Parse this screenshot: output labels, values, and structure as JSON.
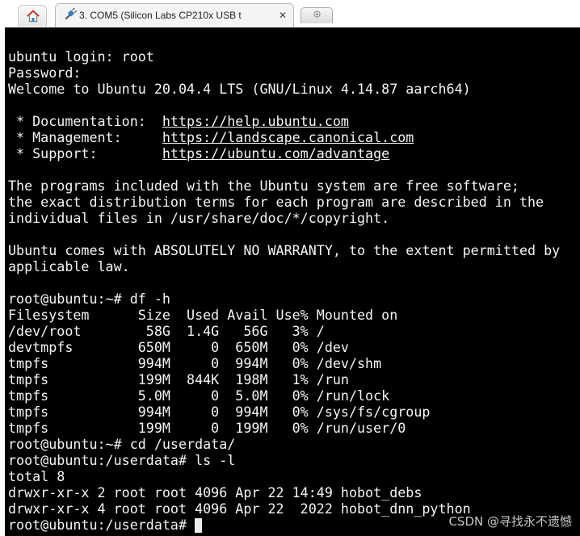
{
  "tabs": {
    "home_icon": "home-icon",
    "session_icon": "serial-plug-icon",
    "session_title": "3. COM5  (Silicon Labs CP210x USB t",
    "close_glyph": "✕",
    "new_tab_icon": "add-tab-icon"
  },
  "terminal": {
    "lines": [
      "ubuntu login: root",
      "Password:",
      "Welcome to Ubuntu 20.04.4 LTS (GNU/Linux 4.14.87 aarch64)",
      "",
      " * Documentation:  ",
      " * Management:     ",
      " * Support:        ",
      "",
      "The programs included with the Ubuntu system are free software;",
      "the exact distribution terms for each program are described in the",
      "individual files in /usr/share/doc/*/copyright.",
      "",
      "Ubuntu comes with ABSOLUTELY NO WARRANTY, to the extent permitted by",
      "applicable law.",
      "",
      "root@ubuntu:~# df -h",
      "Filesystem      Size  Used Avail Use% Mounted on",
      "/dev/root        58G  1.4G   56G   3% /",
      "devtmpfs        650M     0  650M   0% /dev",
      "tmpfs           994M     0  994M   0% /dev/shm",
      "tmpfs           199M  844K  198M   1% /run",
      "tmpfs           5.0M     0  5.0M   0% /run/lock",
      "tmpfs           994M     0  994M   0% /sys/fs/cgroup",
      "tmpfs           199M     0  199M   0% /run/user/0",
      "root@ubuntu:~# cd /userdata/",
      "root@ubuntu:/userdata# ls -l",
      "total 8",
      "drwxr-xr-x 2 root root 4096 Apr 22 14:49 hobot_debs",
      "drwxr-xr-x 4 root root 4096 Apr 22  2022 hobot_dnn_python",
      "root@ubuntu:/userdata# "
    ],
    "links": {
      "documentation": "https://help.ubuntu.com",
      "management": "https://landscape.canonical.com",
      "support": "https://ubuntu.com/advantage"
    }
  },
  "watermark": "CSDN @寻找永不遗憾",
  "colors": {
    "terminal_background": "#000000",
    "terminal_text": "#f4f4f4",
    "tab_background": "#f4f4f4"
  }
}
